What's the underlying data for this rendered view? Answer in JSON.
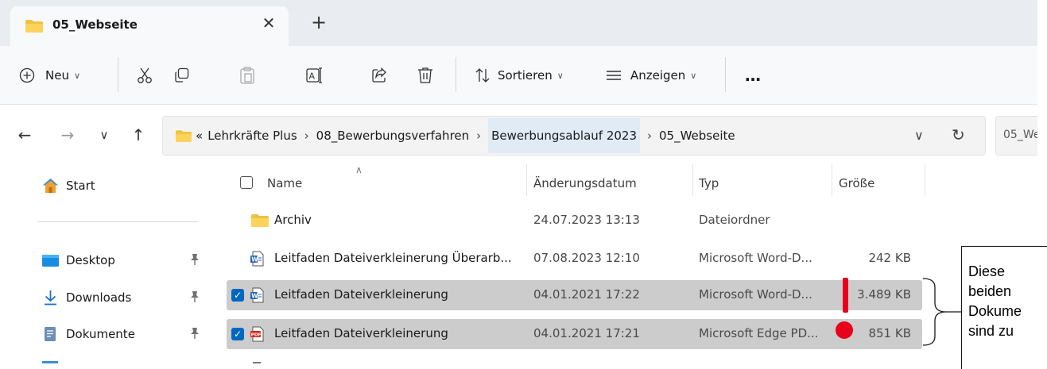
{
  "tab": {
    "title": "05_Webseite",
    "close_icon": "close-icon",
    "newtab_icon": "plus-icon"
  },
  "toolbar": {
    "new_label": "Neu",
    "sort_label": "Sortieren",
    "view_label": "Anzeigen",
    "more_label": "…",
    "icons": [
      "add-circle-icon",
      "cut-icon",
      "copy-icon",
      "paste-icon",
      "rename-icon",
      "share-icon",
      "delete-icon",
      "sort-icon",
      "view-icon",
      "more-icon"
    ]
  },
  "address": {
    "overflow": "«",
    "crumbs": [
      "Lehrkräfte Plus",
      "08_Bewerbungsverfahren",
      "Bewerbungsablauf 2023",
      "05_Webseite"
    ],
    "search_placeholder": "05_We"
  },
  "nav": {
    "items": [
      {
        "label": "Start",
        "icon": "home-icon"
      },
      {
        "label": "Desktop",
        "icon": "desktop-icon",
        "pinned": true
      },
      {
        "label": "Downloads",
        "icon": "download-icon",
        "pinned": true
      },
      {
        "label": "Dokumente",
        "icon": "document-icon",
        "pinned": true
      }
    ]
  },
  "columns": {
    "name": "Name",
    "date": "Änderungsdatum",
    "type": "Typ",
    "size": "Größe"
  },
  "files": [
    {
      "name": "Archiv",
      "date": "24.07.2023 13:13",
      "type": "Dateiordner",
      "size": "",
      "icon": "folder-icon",
      "selected": false
    },
    {
      "name": "Leitfaden Dateiverkleinerung Überarb...",
      "date": "07.08.2023 12:10",
      "type": "Microsoft Word-D...",
      "size": "242 KB",
      "icon": "word-file-icon",
      "selected": false
    },
    {
      "name": "Leitfaden Dateiverkleinerung",
      "date": "04.01.2021 17:22",
      "type": "Microsoft Word-D...",
      "size": "3.489 KB",
      "icon": "word-file-icon",
      "selected": true
    },
    {
      "name": "Leitfaden Dateiverkleinerung",
      "date": "04.01.2021 17:21",
      "type": "Microsoft Edge PD...",
      "size": "851 KB",
      "icon": "pdf-file-icon",
      "selected": true
    }
  ],
  "annotation": {
    "lines": [
      "Diese",
      "beiden",
      "Dokume",
      "sind zu"
    ],
    "marker_color": "#e8001c"
  },
  "colors": {
    "accent": "#0067c0",
    "folder": "#f0c243",
    "selection": "#cccccc",
    "tabstrip": "#e9edf2"
  }
}
